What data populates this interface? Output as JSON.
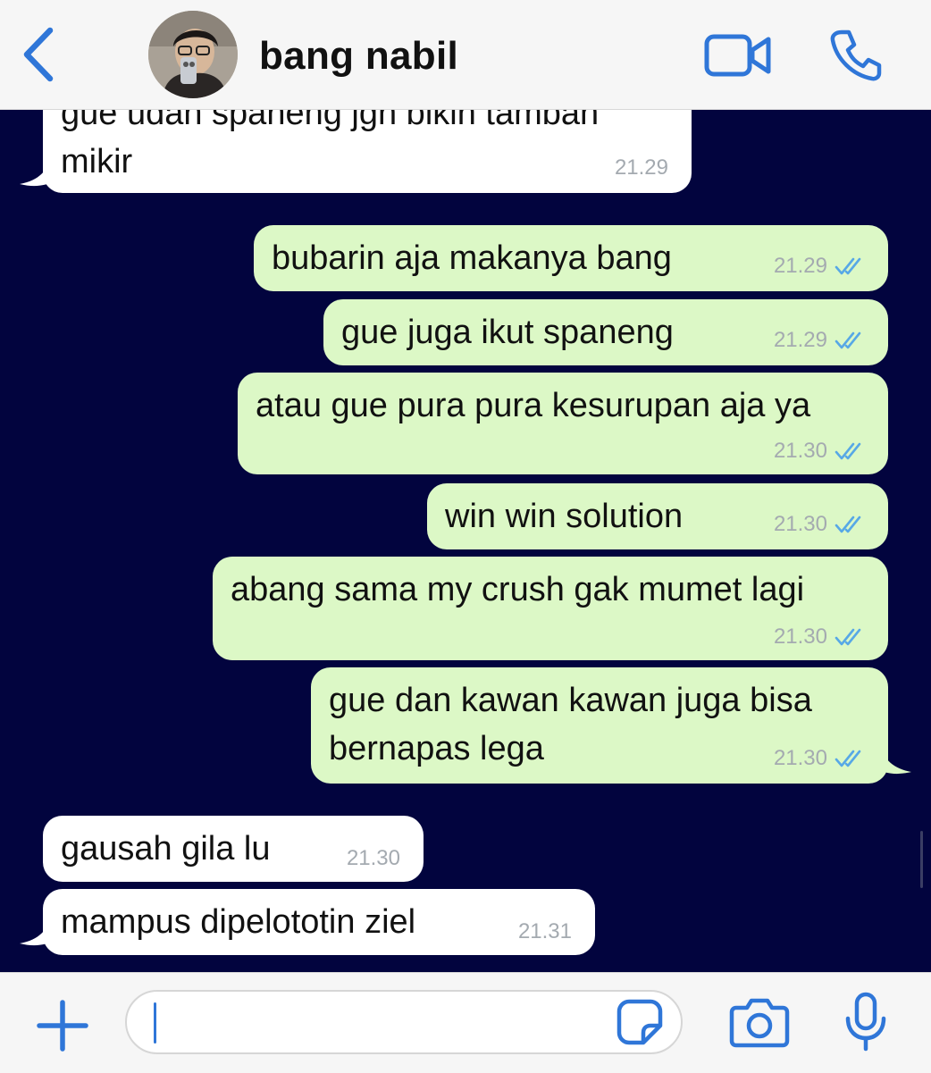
{
  "header": {
    "contact_name": "bang nabil"
  },
  "messages": [
    {
      "side": "in",
      "lines": [
        "gue udah spaneng jgn bikin tambah",
        "mikir"
      ],
      "time": "21.29"
    },
    {
      "side": "out",
      "lines": [
        "bubarin aja makanya bang"
      ],
      "time": "21.29",
      "read": true
    },
    {
      "side": "out",
      "lines": [
        "gue juga ikut spaneng"
      ],
      "time": "21.29",
      "read": true
    },
    {
      "side": "out",
      "lines": [
        "atau gue pura pura kesurupan aja ya"
      ],
      "time": "21.30",
      "read": true
    },
    {
      "side": "out",
      "lines": [
        "win win solution"
      ],
      "time": "21.30",
      "read": true
    },
    {
      "side": "out",
      "lines": [
        "abang sama my crush gak mumet lagi"
      ],
      "time": "21.30",
      "read": true
    },
    {
      "side": "out",
      "lines": [
        "gue dan kawan kawan juga bisa",
        "bernapas lega"
      ],
      "time": "21.30",
      "read": true
    },
    {
      "side": "in",
      "lines": [
        "gausah gila lu"
      ],
      "time": "21.30"
    },
    {
      "side": "in",
      "lines": [
        "mampus dipelototin ziel"
      ],
      "time": "21.31"
    }
  ],
  "composer": {
    "text": ""
  },
  "colors": {
    "chat_background": "#02043e",
    "outgoing_bubble": "#dcf8c6",
    "incoming_bubble": "#ffffff",
    "accent": "#2f76d8",
    "read_ticks": "#57a8e6"
  }
}
